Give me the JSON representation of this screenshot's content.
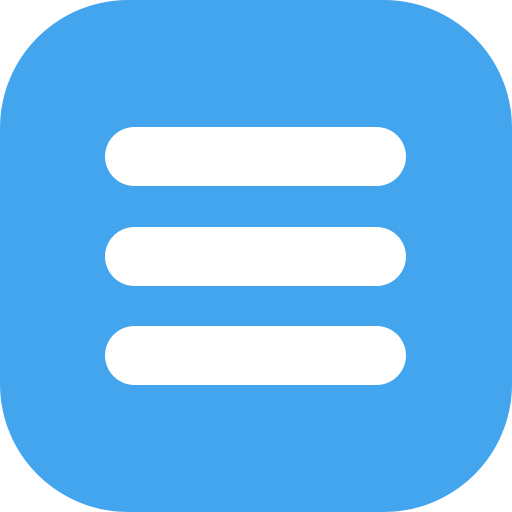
{
  "icon": {
    "name": "hamburger-menu-icon",
    "background_color": "#42A5EE",
    "line_color": "#FFFFFF",
    "line_count": 3
  }
}
